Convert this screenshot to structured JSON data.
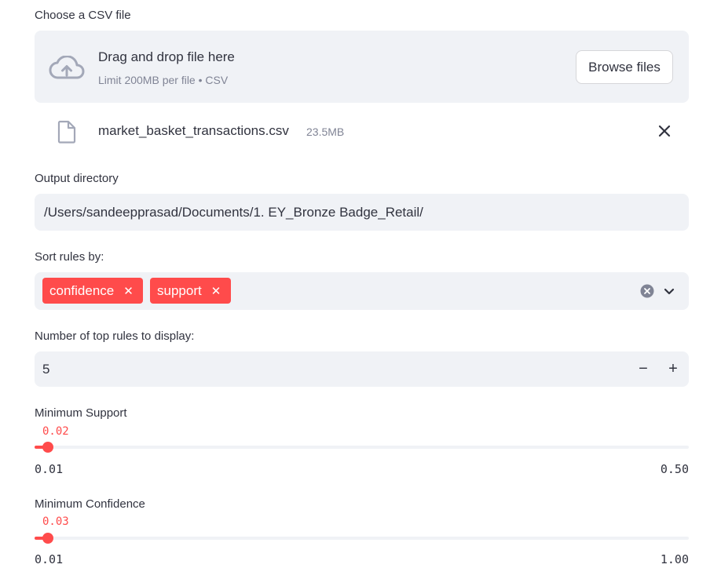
{
  "uploader": {
    "label": "Choose a CSV file",
    "drop_title": "Drag and drop file here",
    "drop_subtitle": "Limit 200MB per file • CSV",
    "browse_label": "Browse files",
    "upload_icon": "cloud-upload-icon",
    "file": {
      "name": "market_basket_transactions.csv",
      "size": "23.5MB",
      "icon": "file-icon"
    }
  },
  "output_dir": {
    "label": "Output directory",
    "value": "/Users/sandeepprasad/Documents/1. EY_Bronze Badge_Retail/"
  },
  "sort_rules": {
    "label": "Sort rules by:",
    "tags": [
      "confidence",
      "support"
    ]
  },
  "top_rules": {
    "label": "Number of top rules to display:",
    "value": "5",
    "minus": "−",
    "plus": "+"
  },
  "min_support": {
    "label": "Minimum Support",
    "value": "0.02",
    "min": "0.01",
    "max": "0.50",
    "fraction": 0.0204
  },
  "min_confidence": {
    "label": "Minimum Confidence",
    "value": "0.03",
    "min": "0.01",
    "max": "1.00",
    "fraction": 0.0202
  },
  "colors": {
    "accent": "#ff4b4b",
    "input_bg": "#f0f2f6",
    "text": "#31333f",
    "muted": "#808495"
  }
}
